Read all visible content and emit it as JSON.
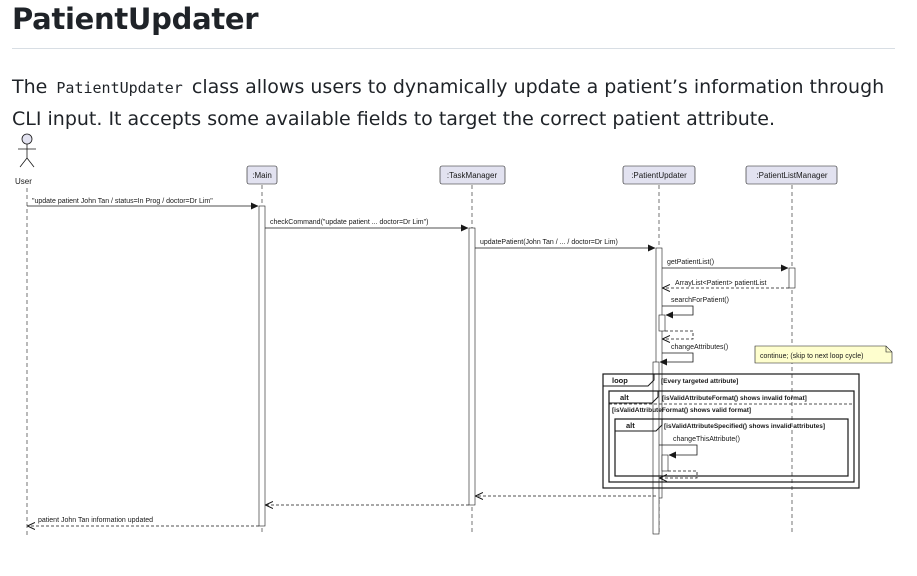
{
  "doc": {
    "heading": "PatientUpdater",
    "paragraph": {
      "prefix": "The ",
      "code": "PatientUpdater",
      "suffix": " class allows users to dynamically update a patient’s information through CLI input. It accepts some available fields to target the correct patient attribute."
    }
  },
  "diagram": {
    "actor_label": "User",
    "participants": [
      ":Main",
      ":TaskManager",
      ":PatientUpdater",
      ":PatientListManager"
    ],
    "messages": {
      "m1": "\"update patient John Tan / status=In Prog / doctor=Dr Lim\"",
      "m2": "checkCommand(\"update patient ... doctor=Dr Lim\")",
      "m3": "updatePatient(John Tan / ... / doctor=Dr Lim)",
      "m4": "getPatientList()",
      "m5": "ArrayList<Patient> patientList",
      "m6": "searchForPatient()",
      "m7": "changeAttributes()",
      "m8": "changeThisAttribute()",
      "m9": "patient John Tan information updated"
    },
    "note": "continue; (skip to next loop cycle)",
    "fragments": {
      "loop_op": "loop",
      "loop_guard": "[Every targeted attribute]",
      "alt1_op": "alt",
      "alt1_guard": "[isValidAttributeFormat() shows invalid format]",
      "alt1_else": "[isValidAttributeFormat() shows valid format]",
      "alt2_op": "alt",
      "alt2_guard": "[isValidAttributeSpecified() shows invalid attributes]"
    }
  }
}
